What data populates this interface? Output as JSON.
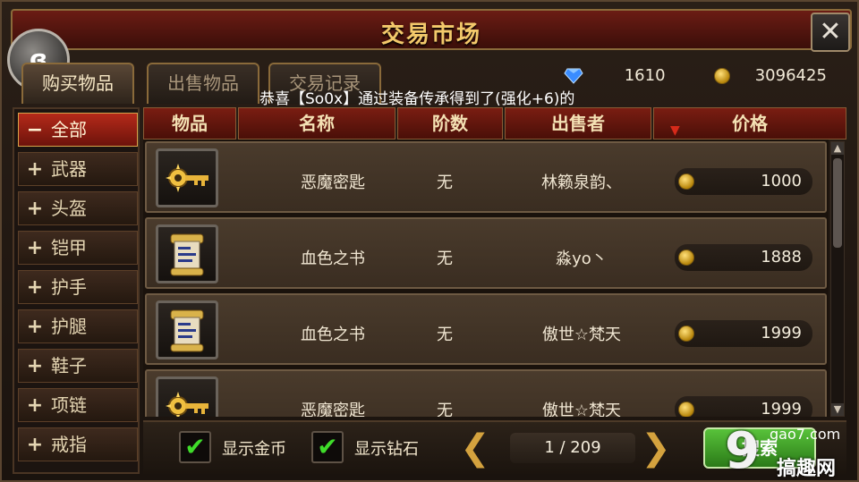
{
  "title": "交易市场",
  "tabs": [
    "购买物品",
    "出售物品",
    "交易记录"
  ],
  "currency": {
    "diamonds": "1610",
    "gold": "3096425"
  },
  "announcement": "恭喜【So0x】通过装备传承得到了(强化+6)的",
  "sidebar": [
    {
      "sym": "−",
      "label": "全部"
    },
    {
      "sym": "+",
      "label": "武器"
    },
    {
      "sym": "+",
      "label": "头盔"
    },
    {
      "sym": "+",
      "label": "铠甲"
    },
    {
      "sym": "+",
      "label": "护手"
    },
    {
      "sym": "+",
      "label": "护腿"
    },
    {
      "sym": "+",
      "label": "鞋子"
    },
    {
      "sym": "+",
      "label": "项链"
    },
    {
      "sym": "+",
      "label": "戒指"
    }
  ],
  "columns": [
    "物品",
    "名称",
    "阶数",
    "出售者",
    "价格"
  ],
  "rows": [
    {
      "icon": "key-icon",
      "name": "恶魔密匙",
      "tier": "无",
      "seller": "林籁泉韵、",
      "price": "1000"
    },
    {
      "icon": "scroll-icon",
      "name": "血色之书",
      "tier": "无",
      "seller": "淼yo丶",
      "price": "1888"
    },
    {
      "icon": "scroll-icon",
      "name": "血色之书",
      "tier": "无",
      "seller": "傲世☆梵天",
      "price": "1999"
    },
    {
      "icon": "key-icon",
      "name": "恶魔密匙",
      "tier": "无",
      "seller": "傲世☆梵天",
      "price": "1999"
    }
  ],
  "footer": {
    "show_gold": "显示金币",
    "show_diamond": "显示钻石",
    "page": "1 / 209",
    "search": "搜索"
  },
  "watermark": {
    "url": "gao7.com",
    "cn": "搞趣网"
  },
  "colors": {
    "accent_red": "#7a1d12",
    "gold": "#f3c96b",
    "check_green": "#3fdc2a",
    "search_green": "#58c23a"
  }
}
